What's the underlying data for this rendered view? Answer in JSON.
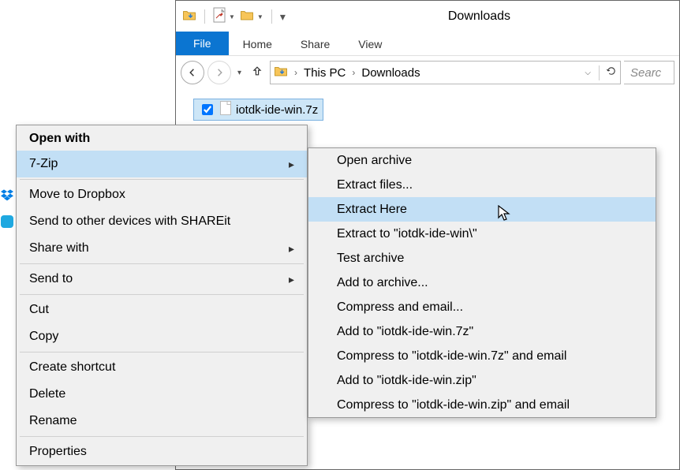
{
  "window": {
    "title": "Downloads"
  },
  "ribbon": {
    "file": "File",
    "tabs": [
      "Home",
      "Share",
      "View"
    ]
  },
  "breadcrumb": {
    "root": "This PC",
    "folder": "Downloads"
  },
  "search": {
    "placeholder": "Searc"
  },
  "file": {
    "name": "iotdk-ide-win.7z"
  },
  "context_menu": {
    "header": "Open with",
    "items": [
      {
        "label": "7-Zip",
        "submenu": true,
        "highlight": true
      },
      {
        "label": "Move to Dropbox",
        "icon": "dropbox"
      },
      {
        "label": "Send to other devices with SHAREit",
        "icon": "shareit"
      },
      {
        "label": "Share with",
        "submenu": true
      },
      {
        "label": "Send to",
        "submenu": true
      },
      {
        "label": "Cut"
      },
      {
        "label": "Copy"
      },
      {
        "label": "Create shortcut"
      },
      {
        "label": "Delete"
      },
      {
        "label": "Rename"
      },
      {
        "label": "Properties"
      }
    ]
  },
  "submenu_7zip": [
    {
      "label": "Open archive"
    },
    {
      "label": "Extract files..."
    },
    {
      "label": "Extract Here",
      "highlight": true
    },
    {
      "label": "Extract to \"iotdk-ide-win\\\""
    },
    {
      "label": "Test archive"
    },
    {
      "label": "Add to archive..."
    },
    {
      "label": "Compress and email..."
    },
    {
      "label": "Add to \"iotdk-ide-win.7z\""
    },
    {
      "label": "Compress to \"iotdk-ide-win.7z\" and email"
    },
    {
      "label": "Add to \"iotdk-ide-win.zip\""
    },
    {
      "label": "Compress to \"iotdk-ide-win.zip\" and email"
    }
  ]
}
